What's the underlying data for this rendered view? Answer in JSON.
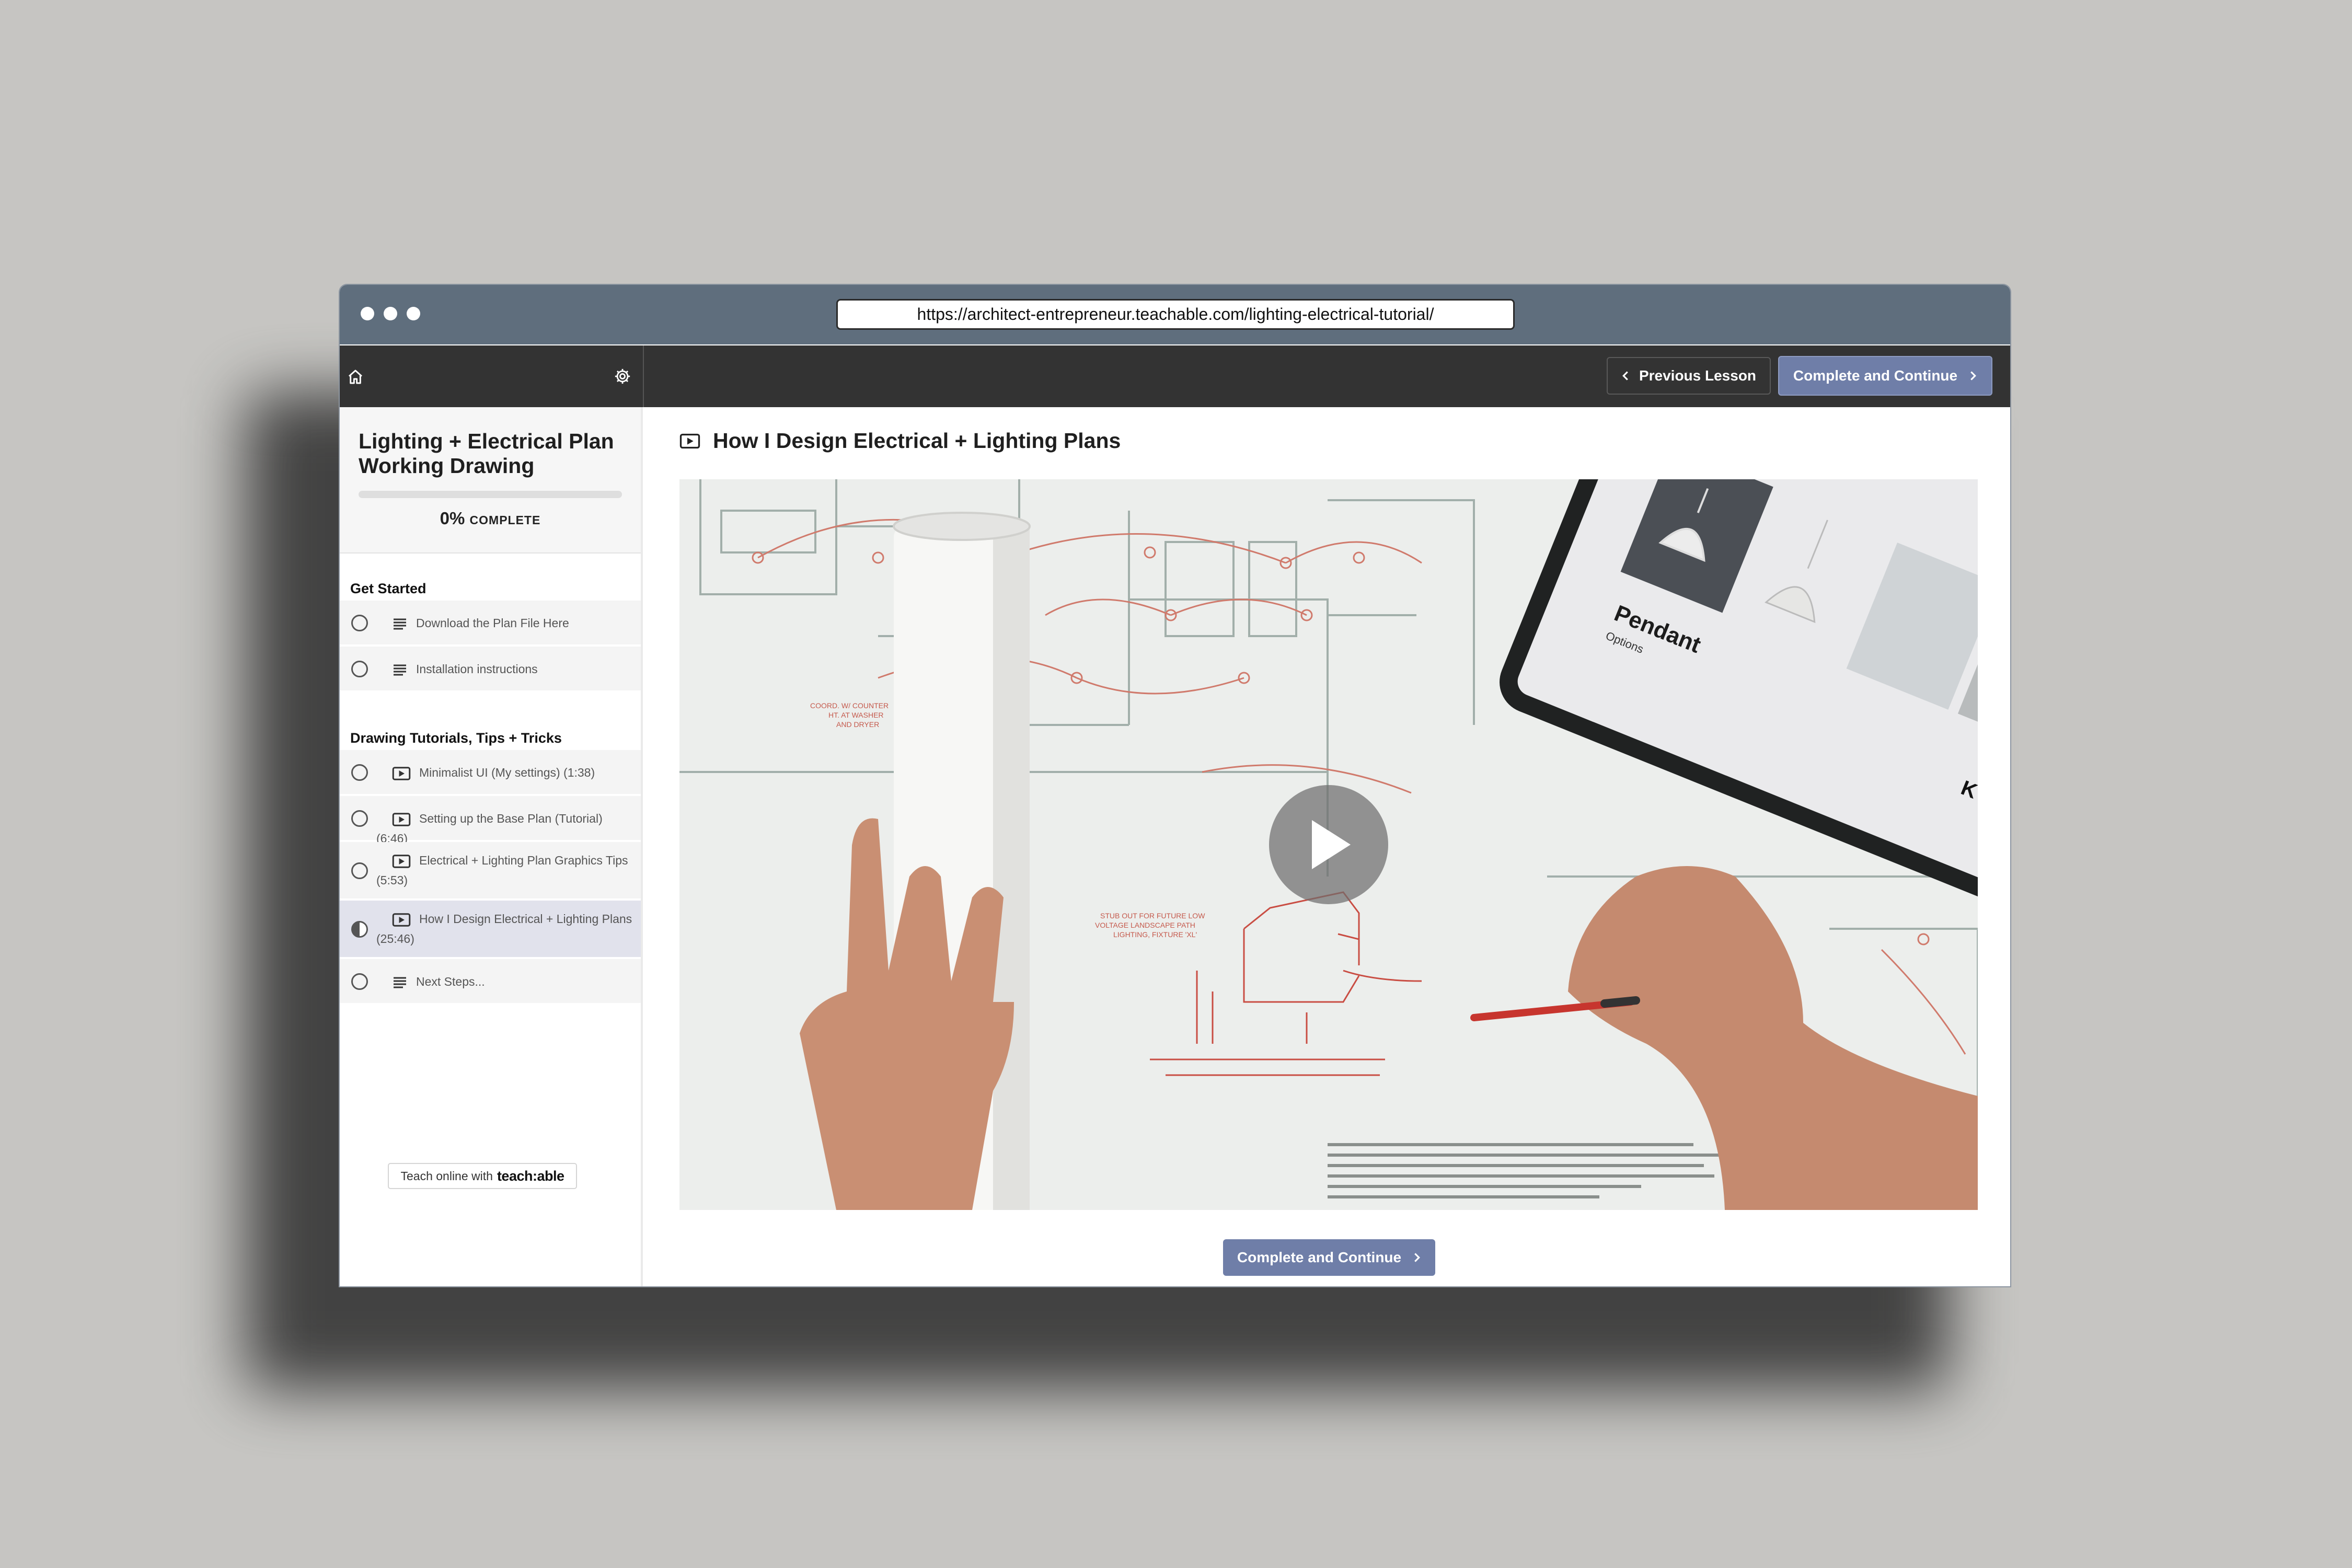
{
  "browser": {
    "url": "https://architect-entrepreneur.teachable.com/lighting-electrical-tutorial/"
  },
  "topbar": {
    "previous_label": "Previous Lesson",
    "complete_label": "Complete and Continue"
  },
  "course": {
    "title": "Lighting + Electrical Plan Working Drawing",
    "progress_value": "0%",
    "progress_label": "COMPLETE",
    "progress_fraction": 0
  },
  "sections": [
    {
      "title": "Get Started",
      "lessons": [
        {
          "label": "Download the Plan File Here",
          "type": "text",
          "status": "incomplete"
        },
        {
          "label": "Installation instructions",
          "type": "text",
          "status": "incomplete"
        }
      ]
    },
    {
      "title": "Drawing Tutorials, Tips + Tricks",
      "lessons": [
        {
          "label": "Minimalist UI (My settings) (1:38)",
          "type": "video",
          "status": "incomplete"
        },
        {
          "label": "Setting up the Base Plan (Tutorial) (6:46)",
          "type": "video",
          "status": "incomplete"
        },
        {
          "label": "Electrical + Lighting Plan Graphics Tips (5:53)",
          "type": "video",
          "status": "incomplete"
        },
        {
          "label": "How I Design Electrical + Lighting Plans (25:46)",
          "type": "video",
          "status": "in-progress"
        },
        {
          "label": "Next Steps...",
          "type": "text",
          "status": "incomplete"
        }
      ]
    }
  ],
  "footer": {
    "teach_prefix": "Teach online with",
    "teach_brand": "teach:able"
  },
  "lecture": {
    "title": "How I Design Electrical + Lighting Plans",
    "complete_label": "Complete and Continue"
  },
  "video_image": {
    "blueprint_note_1": "COORD. W/ COUNTER HT. AT WASHER AND DRYER",
    "blueprint_note_2": "STUB OUT FOR FUTURE LOW VOLTAGE LANDSCAPE PATH LIGHTING, FIXTURE 'XL'",
    "tablet_heading": "Pendant",
    "tablet_sub": "Options",
    "tablet_letter": "K"
  },
  "colors": {
    "accent": "#6f7ea8",
    "titlebar": "#5f6e7d",
    "topbar": "#333333",
    "active_lesson": "#e1e2ec"
  }
}
